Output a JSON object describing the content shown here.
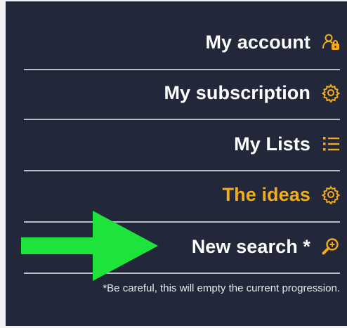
{
  "menu": {
    "items": [
      {
        "label": "My account",
        "icon": "user-lock-icon",
        "active": false
      },
      {
        "label": "My subscription",
        "icon": "gear-icon",
        "active": false
      },
      {
        "label": "My Lists",
        "icon": "list-icon",
        "active": false
      },
      {
        "label": "The ideas",
        "icon": "gear-icon",
        "active": true
      },
      {
        "label": "New search *",
        "icon": "magnifier-icon",
        "active": false
      }
    ],
    "note": "*Be careful, this will empty the current progression."
  },
  "colors": {
    "panel_bg": "#22283a",
    "text": "#ffffff",
    "accent": "#f3ad1b",
    "divider": "#b9bcc6",
    "arrow": "#1ee33a"
  }
}
